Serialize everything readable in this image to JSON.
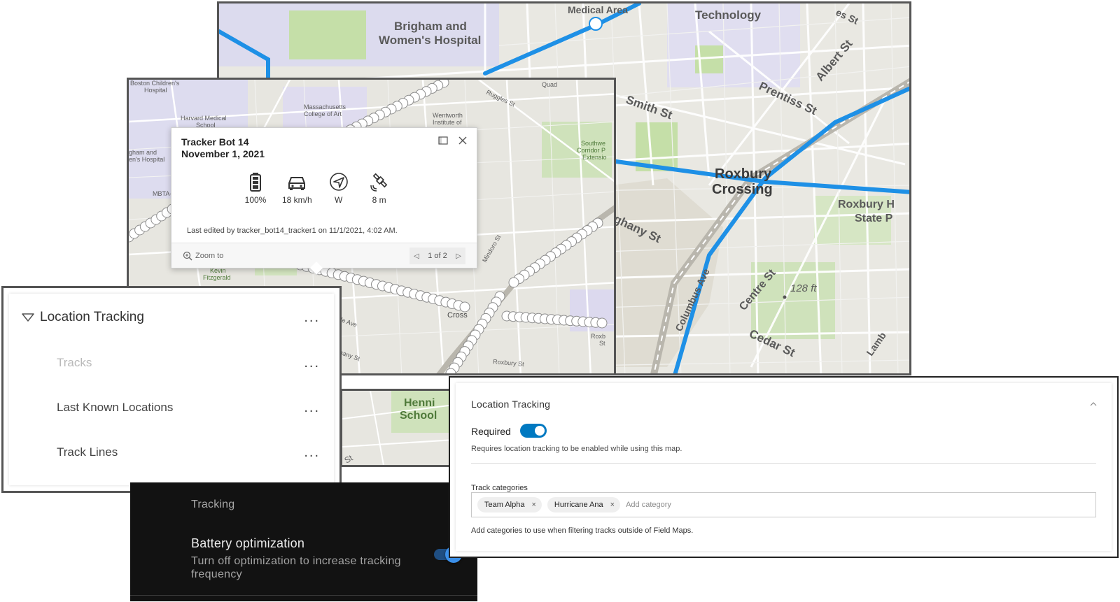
{
  "back_map": {
    "labels": {
      "medical_area": "Medical Area",
      "technology": "Technology",
      "es_st": "es St",
      "brigham_1": "Brigham and",
      "brigham_2": "Women's Hospital",
      "albert_st": "Albert St",
      "prentiss_st": "Prentiss St",
      "smith_st": "Smith St",
      "roxbury_1": "Roxbury",
      "roxbury_2": "Crossing",
      "roxbury_hs_1": "Roxbury H",
      "roxbury_hs_2": "State P",
      "eghany_st": "eghany St",
      "columbus_ave": "Columbus Ave",
      "centre_st": "Centre St",
      "elevation": "128 ft",
      "cedar_st": "Cedar St",
      "lamb": "Lamb"
    }
  },
  "mid_map": {
    "labels": {
      "boston_childrens_1": "Boston Children's",
      "boston_childrens_2": "Hospital",
      "harvard_1": "Harvard Medical",
      "harvard_2": "School",
      "massart_1": "Massachusetts",
      "massart_2": "College of Art",
      "quad": "Quad",
      "ruggles_st": "Ruggles St",
      "wentworth_1": "Wentworth",
      "wentworth_2": "Institute of",
      "southwest_1": "Southwe",
      "southwest_2": "Corridor P",
      "southwest_3": "Extensio",
      "brigham_1": "gham and",
      "brigham_2": "en's Hospital",
      "mbta": "MBTA-",
      "kevin_1": "Kevin",
      "kevin_2": "Fitzgerald",
      "mindoro_st": "Mindoro St",
      "ile_ave": "ile Ave",
      "hany_st": "hany St",
      "cross": "Cross",
      "roxb_1": "Roxb",
      "roxb_2": "St",
      "roxbury_st": "Roxbury St"
    }
  },
  "small_map": {
    "labels": {
      "henni_1": "Henni",
      "henni_2": "School",
      "st": "St"
    }
  },
  "popup": {
    "title_line1": "Tracker Bot 14",
    "title_line2": "November 1, 2021",
    "stats": [
      {
        "icon": "battery-icon",
        "value": "100%"
      },
      {
        "icon": "car-icon",
        "value": "18 km/h"
      },
      {
        "icon": "compass-icon",
        "value": "W"
      },
      {
        "icon": "satellite-icon",
        "value": "8 m"
      }
    ],
    "edited_text": "Last edited by tracker_bot14_tracker1 on 11/1/2021, 4:02 AM.",
    "zoom_label": "Zoom to",
    "pager_text": "1 of 2"
  },
  "layer_list": {
    "group_title": "Location Tracking",
    "more_label": "...",
    "items": [
      {
        "label": "Tracks",
        "disabled": true
      },
      {
        "label": "Last Known Locations",
        "disabled": false
      },
      {
        "label": "Track Lines",
        "disabled": false
      }
    ]
  },
  "dark_settings": {
    "section": "Tracking",
    "option_title": "Battery optimization",
    "option_desc": "Turn off optimization to increase tracking frequency",
    "toggle_on": true,
    "accent": "#3b8fe8"
  },
  "settings_panel": {
    "header": "Location Tracking",
    "required_label": "Required",
    "required_on": true,
    "required_desc": "Requires location tracking to be enabled while using this map.",
    "categories_label": "Track categories",
    "chips": [
      "Team Alpha",
      "Hurricane Ana"
    ],
    "chip_remove": "×",
    "add_placeholder": "Add category",
    "help_text": "Add categories to use when filtering tracks outside of Field Maps.",
    "accent": "#0079c1"
  },
  "colors": {
    "route_blue": "#1e90e6",
    "map_bg": "#e9e8e2",
    "park_green": "#c5dfa8"
  }
}
